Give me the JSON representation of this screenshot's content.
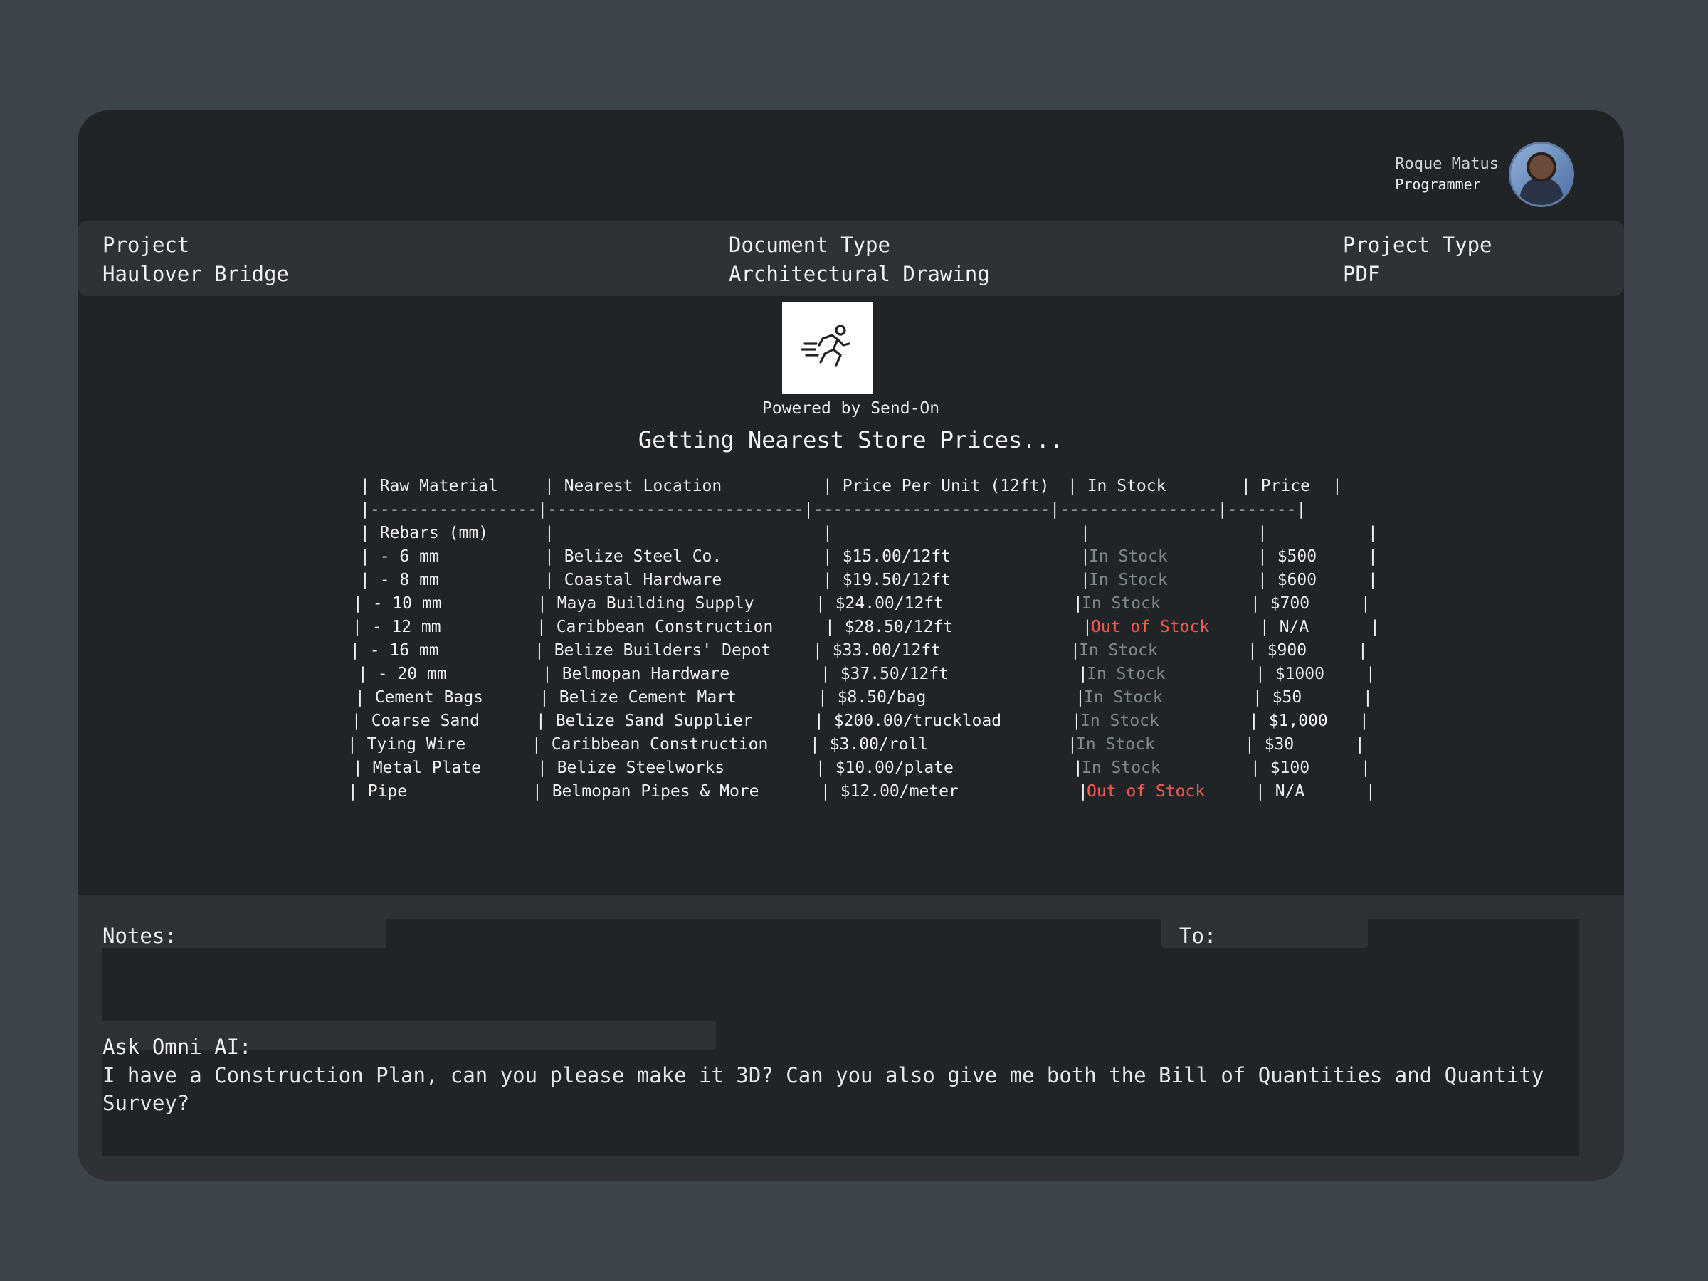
{
  "user": {
    "name": "Roque Matus",
    "role": "Programmer"
  },
  "meta": {
    "project_label": "Project",
    "project_value": "Haulover Bridge",
    "doc_type_label": "Document Type",
    "doc_type_value": "Architectural Drawing",
    "project_type_label": "Project Type",
    "project_type_value": "PDF"
  },
  "branding": {
    "powered_by": "Powered by Send-On",
    "logo_icon": "running-person-icon"
  },
  "status_heading": "Getting Nearest Store Prices...",
  "table": {
    "headers": [
      "| Raw Material",
      "| Nearest Location",
      "| Price Per Unit (12ft)",
      "| In Stock",
      "| Price",
      "|"
    ],
    "separator": "|-----------------|--------------------------|------------------------|----------------|-------|",
    "rows": [
      [
        "| Rebars (mm)",
        "|",
        "|",
        "|",
        "|",
        "|"
      ],
      [
        "| - 6 mm",
        "| Belize Steel Co.",
        "| $15.00/12ft",
        "| ",
        "In Stock",
        "| $500",
        "|"
      ],
      [
        "| - 8 mm",
        "| Coastal Hardware",
        "| $19.50/12ft",
        "| ",
        "In Stock",
        "| $600",
        "|"
      ],
      [
        "| - 10 mm",
        "| Maya Building Supply",
        "| $24.00/12ft",
        "| ",
        "In Stock",
        "| $700",
        "|"
      ],
      [
        "| - 12 mm",
        "| Caribbean Construction",
        "| $28.50/12ft",
        "| ",
        "Out of Stock",
        "| N/A",
        "|"
      ],
      [
        "| - 16 mm",
        "| Belize Builders' Depot",
        "| $33.00/12ft",
        "| ",
        "In Stock",
        "| $900",
        "|"
      ],
      [
        "| - 20 mm",
        "| Belmopan Hardware",
        "| $37.50/12ft",
        "| ",
        "In Stock",
        "| $1000",
        "|"
      ],
      [
        "| Cement Bags",
        "| Belize Cement Mart",
        "| $8.50/bag",
        "| ",
        "In Stock",
        "| $50",
        "|"
      ],
      [
        "| Coarse Sand",
        "| Belize Sand Supplier",
        "| $200.00/truckload",
        "| ",
        "In Stock",
        "| $1,000",
        "|"
      ],
      [
        "| Tying Wire",
        "| Caribbean Construction",
        "| $3.00/roll",
        "| ",
        "In Stock",
        "| $30",
        "|"
      ],
      [
        "| Metal Plate",
        "| Belize Steelworks",
        "| $10.00/plate",
        "| ",
        "In Stock",
        "| $100",
        "|"
      ],
      [
        "| Pipe",
        "| Belmopan Pipes & More",
        "| $12.00/meter",
        "| ",
        "Out of Stock",
        "| N/A",
        "|"
      ]
    ]
  },
  "notes": {
    "label": "Notes:",
    "to_label": "To:"
  },
  "ask": {
    "label": "Ask Omni AI:",
    "text": "I have a Construction Plan, can you please make it 3D? Can you also give me both the Bill of Quantities and Quantity Survey?"
  },
  "colors": {
    "in_stock": "#7e8a88",
    "out_of_stock": "#ff5a52"
  }
}
